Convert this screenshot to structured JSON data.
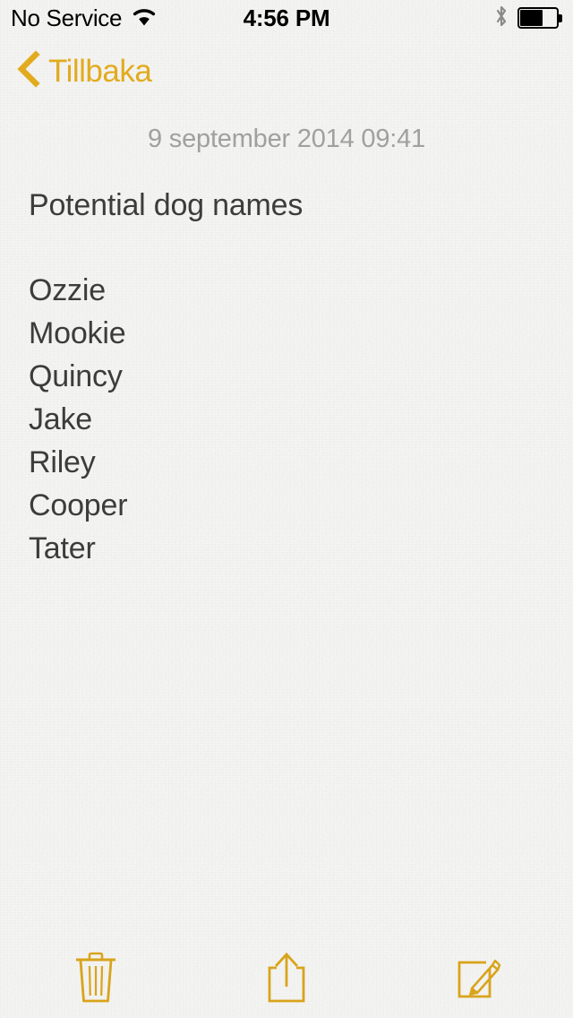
{
  "status_bar": {
    "carrier": "No Service",
    "wifi_icon": "wifi-icon",
    "time": "4:56 PM",
    "bluetooth_icon": "bluetooth-icon",
    "battery_icon": "battery-icon",
    "battery_level_percent": 62
  },
  "nav_bar": {
    "back_icon": "chevron-left-icon",
    "back_label": "Tillbaka"
  },
  "note": {
    "date": "9 september 2014 09:41",
    "title": "Potential dog names",
    "lines": [
      "Ozzie",
      "Mookie",
      "Quincy",
      "Jake",
      "Riley",
      "Cooper",
      "Tater"
    ]
  },
  "toolbar": {
    "delete_icon": "trash-icon",
    "share_icon": "share-icon",
    "compose_icon": "compose-icon"
  },
  "colors": {
    "accent": "#e2ab1e",
    "paper": "#f4f4f2",
    "text": "#3c3c3c",
    "muted_text": "#a0a0a0"
  }
}
